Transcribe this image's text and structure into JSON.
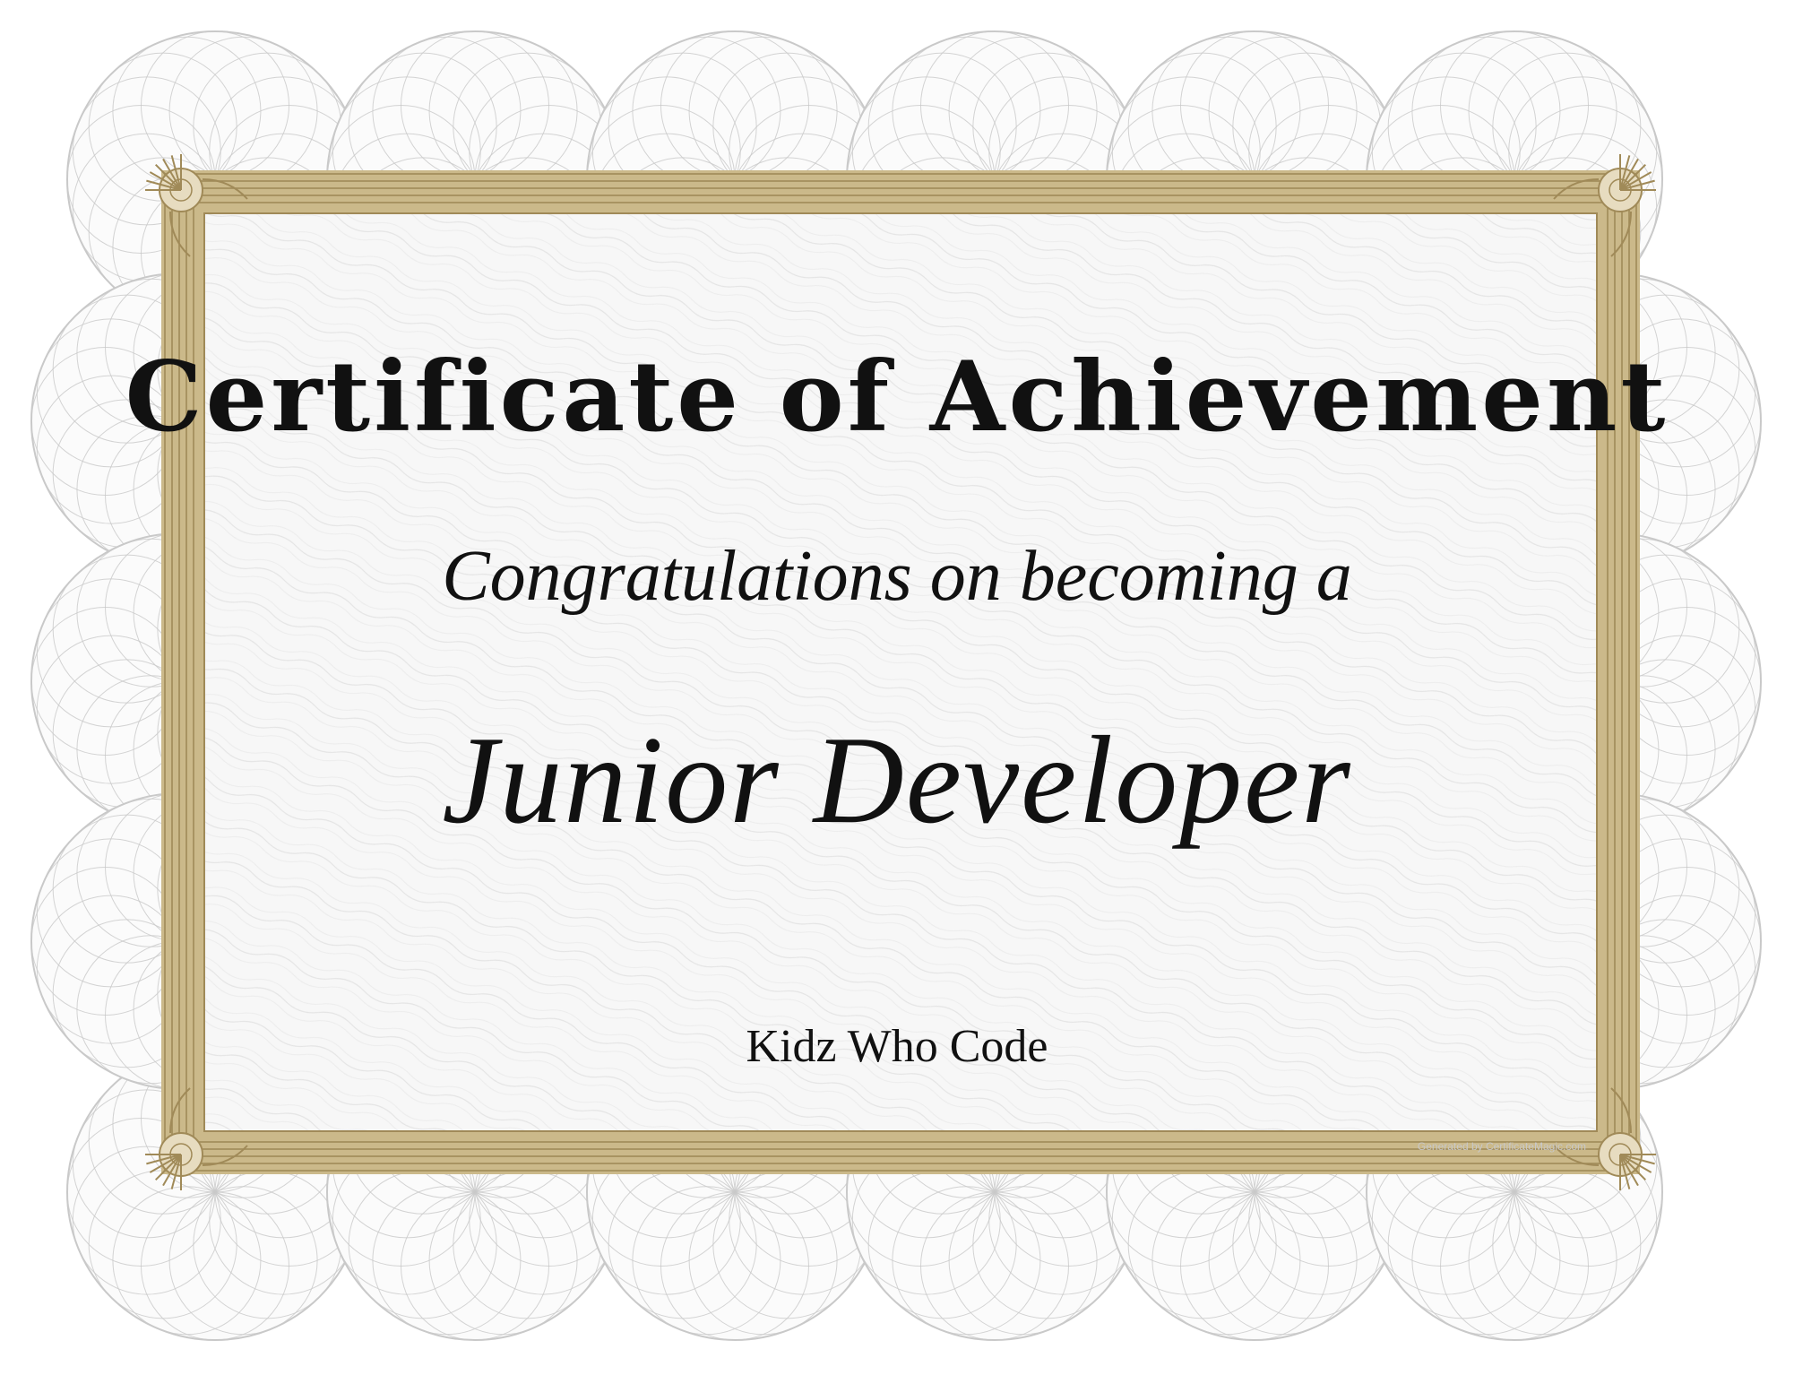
{
  "certificate": {
    "title": "Certificate of Achievement",
    "subtitle": "Congratulations on becoming a",
    "award": "Junior Developer",
    "issuer": "Kidz Who Code",
    "watermark": "Generated by CertificateMagic.com"
  },
  "colors": {
    "guilloche": "#c9c9c9",
    "frame_gold": "#a08a58",
    "frame_gold_light": "#cbb98a",
    "panel_bg": "#f7f7f7",
    "text": "#111111"
  }
}
